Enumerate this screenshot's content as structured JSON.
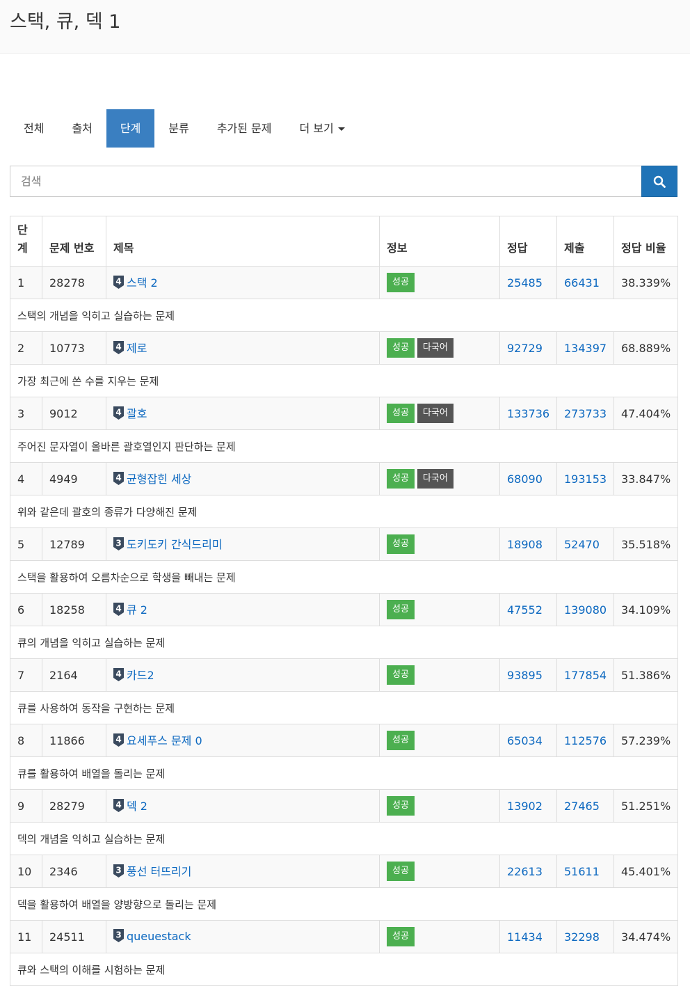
{
  "page": {
    "title": "스택, 큐, 덱 1"
  },
  "tabs": [
    {
      "label": "전체"
    },
    {
      "label": "출처"
    },
    {
      "label": "단계"
    },
    {
      "label": "분류"
    },
    {
      "label": "추가된 문제"
    },
    {
      "label": "더 보기"
    }
  ],
  "active_tab": "단계",
  "search": {
    "placeholder": "검색",
    "value": ""
  },
  "colors": {
    "accent": "#3a7fc1",
    "search_button": "#1f73b7",
    "success": "#4caf50",
    "multi": "#555555",
    "link": "#0c68c0"
  },
  "table": {
    "headers": {
      "level": "단계",
      "problem_id": "문제 번호",
      "title": "제목",
      "info": "정보",
      "correct": "정답",
      "submit": "제출",
      "ratio": "정답 비율"
    },
    "rows": [
      {
        "level": "1",
        "id": "28278",
        "tier": "4",
        "title": "스택 2",
        "badges": [
          "성공"
        ],
        "correct": "25485",
        "submit": "66431",
        "ratio": "38.339%",
        "desc": "스택의 개념을 익히고 실습하는 문제"
      },
      {
        "level": "2",
        "id": "10773",
        "tier": "4",
        "title": "제로",
        "badges": [
          "성공",
          "다국어"
        ],
        "correct": "92729",
        "submit": "134397",
        "ratio": "68.889%",
        "desc": "가장 최근에 쓴 수를 지우는 문제"
      },
      {
        "level": "3",
        "id": "9012",
        "tier": "4",
        "title": "괄호",
        "badges": [
          "성공",
          "다국어"
        ],
        "correct": "133736",
        "submit": "273733",
        "ratio": "47.404%",
        "desc": "주어진 문자열이 올바른 괄호열인지 판단하는 문제"
      },
      {
        "level": "4",
        "id": "4949",
        "tier": "4",
        "title": "균형잡힌 세상",
        "badges": [
          "성공",
          "다국어"
        ],
        "correct": "68090",
        "submit": "193153",
        "ratio": "33.847%",
        "desc": "위와 같은데 괄호의 종류가 다양해진 문제"
      },
      {
        "level": "5",
        "id": "12789",
        "tier": "3",
        "title": "도키도키 간식드리미",
        "badges": [
          "성공"
        ],
        "correct": "18908",
        "submit": "52470",
        "ratio": "35.518%",
        "desc": "스택을 활용하여 오름차순으로 학생을 빼내는 문제"
      },
      {
        "level": "6",
        "id": "18258",
        "tier": "4",
        "title": "큐 2",
        "badges": [
          "성공"
        ],
        "correct": "47552",
        "submit": "139080",
        "ratio": "34.109%",
        "desc": "큐의 개념을 익히고 실습하는 문제"
      },
      {
        "level": "7",
        "id": "2164",
        "tier": "4",
        "title": "카드2",
        "badges": [
          "성공"
        ],
        "correct": "93895",
        "submit": "177854",
        "ratio": "51.386%",
        "desc": "큐를 사용하여 동작을 구현하는 문제"
      },
      {
        "level": "8",
        "id": "11866",
        "tier": "4",
        "title": "요세푸스 문제 0",
        "badges": [
          "성공"
        ],
        "correct": "65034",
        "submit": "112576",
        "ratio": "57.239%",
        "desc": "큐를 활용하여 배열을 돌리는 문제"
      },
      {
        "level": "9",
        "id": "28279",
        "tier": "4",
        "title": "덱 2",
        "badges": [
          "성공"
        ],
        "correct": "13902",
        "submit": "27465",
        "ratio": "51.251%",
        "desc": "덱의 개념을 익히고 실습하는 문제"
      },
      {
        "level": "10",
        "id": "2346",
        "tier": "3",
        "title": "풍선 터뜨리기",
        "badges": [
          "성공"
        ],
        "correct": "22613",
        "submit": "51611",
        "ratio": "45.401%",
        "desc": "덱을 활용하여 배열을 양방향으로 돌리는 문제"
      },
      {
        "level": "11",
        "id": "24511",
        "tier": "3",
        "title": "queuestack",
        "badges": [
          "성공"
        ],
        "correct": "11434",
        "submit": "32298",
        "ratio": "34.474%",
        "desc": "큐와 스택의 이해를 시험하는 문제"
      }
    ]
  }
}
